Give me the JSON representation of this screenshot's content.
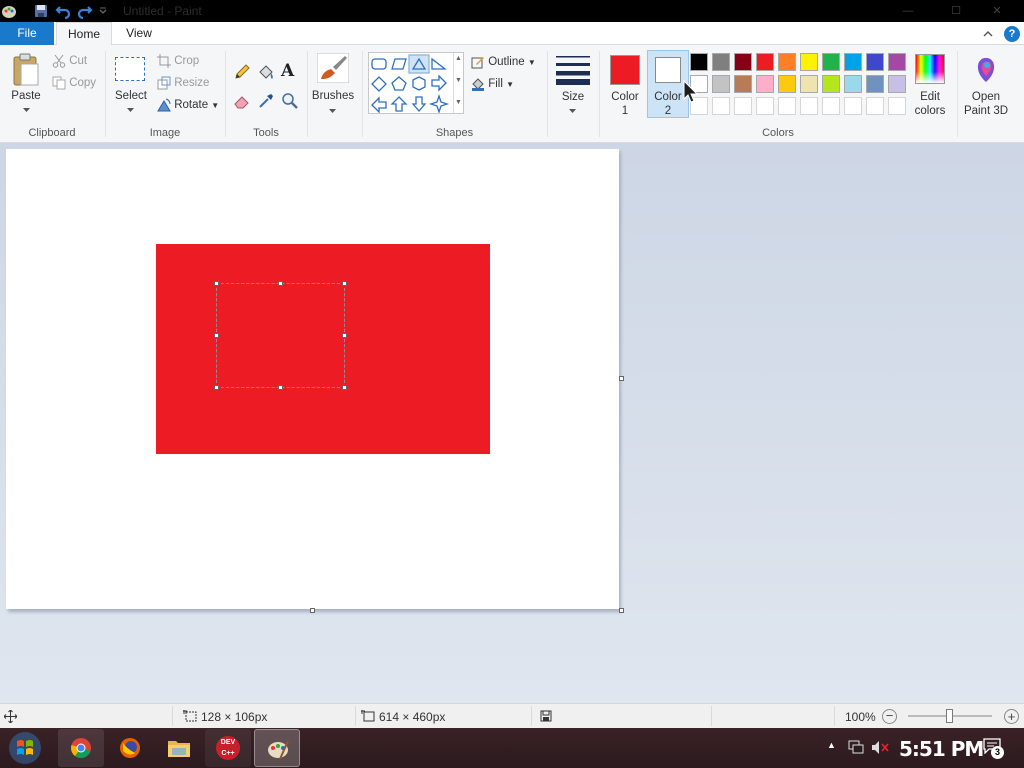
{
  "window": {
    "title": "Untitled - Paint",
    "minimize": "—",
    "maximize": "☐",
    "close": "✕"
  },
  "tabs": {
    "file": "File",
    "home": "Home",
    "view": "View"
  },
  "clipboard": {
    "paste": "Paste",
    "cut": "Cut",
    "copy": "Copy",
    "label": "Clipboard"
  },
  "image": {
    "select": "Select",
    "crop": "Crop",
    "resize": "Resize",
    "rotate": "Rotate",
    "label": "Image"
  },
  "tools": {
    "label": "Tools"
  },
  "brushes": {
    "label": "Brushes"
  },
  "shapes": {
    "outline": "Outline",
    "fill": "Fill",
    "label": "Shapes"
  },
  "size": {
    "label": "Size"
  },
  "colors": {
    "color1_line1": "Color",
    "color1_line2": "1",
    "color2_line1": "Color",
    "color2_line2": "2",
    "edit_line1": "Edit",
    "edit_line2": "colors",
    "label": "Colors",
    "color1": "#ed1c24",
    "color2": "#ffffff",
    "palette_row1": [
      "#000000",
      "#7f7f7f",
      "#880015",
      "#ed1c24",
      "#ff7f27",
      "#fff200",
      "#22b14c",
      "#00a2e8",
      "#3f48cc",
      "#a349a4"
    ],
    "palette_row2": [
      "#ffffff",
      "#c3c3c3",
      "#b97a57",
      "#ffaec9",
      "#ffc90e",
      "#efe4b0",
      "#b5e61d",
      "#99d9ea",
      "#7092be",
      "#c8bfe7"
    ],
    "palette_row3": [
      "#ffffff",
      "#ffffff",
      "#ffffff",
      "#ffffff",
      "#ffffff",
      "#ffffff",
      "#ffffff",
      "#ffffff",
      "#ffffff",
      "#ffffff"
    ]
  },
  "paint3d": {
    "line1": "Open",
    "line2": "Paint 3D"
  },
  "status": {
    "selection_size": "128 × 106px",
    "canvas_size": "614 × 460px",
    "zoom": "100%",
    "zoom_level": 0.5
  },
  "taskbar": {
    "time": "5:51 PM",
    "notification_count": "3",
    "devcpp_label": "DEV C++"
  }
}
